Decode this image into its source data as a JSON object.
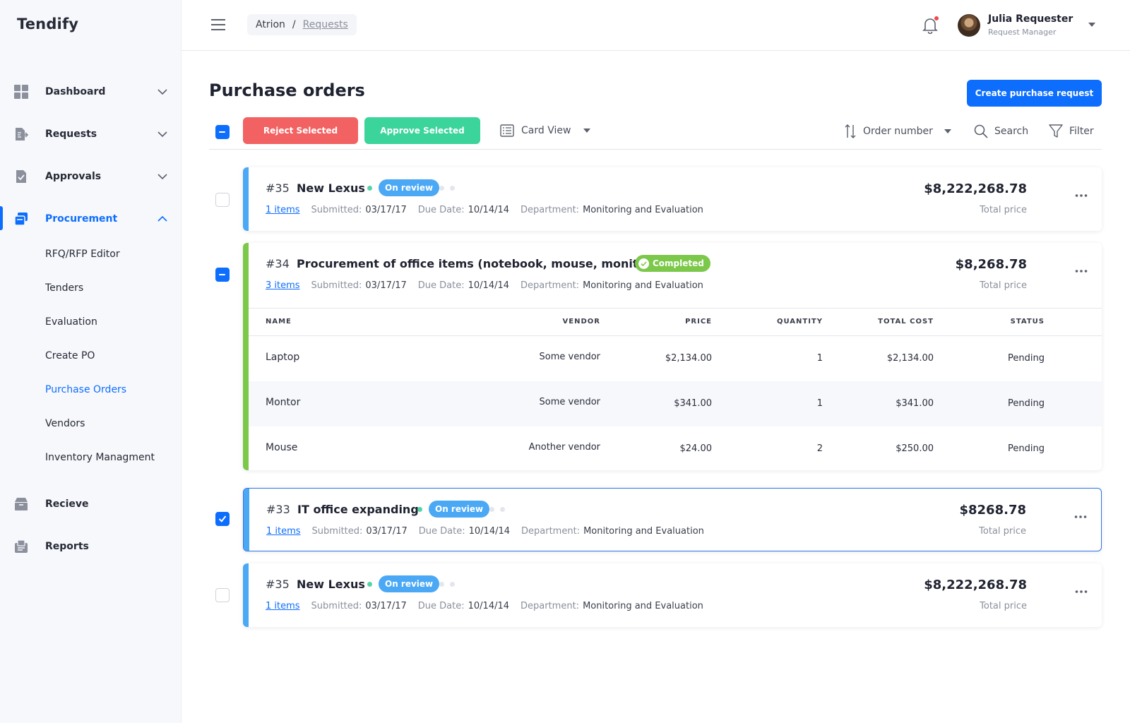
{
  "app": {
    "name": "Tendify"
  },
  "sidebar": {
    "items": [
      {
        "label": "Dashboard"
      },
      {
        "label": "Requests"
      },
      {
        "label": "Approvals"
      },
      {
        "label": "Procurement"
      },
      {
        "label": "Recieve"
      },
      {
        "label": "Reports"
      }
    ],
    "procurement_sub": [
      {
        "label": "RFQ/RFP Editor"
      },
      {
        "label": "Tenders"
      },
      {
        "label": "Evaluation"
      },
      {
        "label": "Create PO"
      },
      {
        "label": "Purchase Orders"
      },
      {
        "label": "Vendors"
      },
      {
        "label": "Inventory Managment"
      }
    ]
  },
  "header": {
    "breadcrumb": {
      "root": "Atrion",
      "separator": "/",
      "current": "Requests"
    },
    "user": {
      "name": "Julia Requester",
      "role": "Request Manager"
    }
  },
  "page": {
    "title": "Purchase orders",
    "create_button": "Create purchase request"
  },
  "toolbar": {
    "reject": "Reject Selected",
    "approve": "Approve Selected",
    "view": "Card View",
    "sort": "Order number",
    "search": "Search",
    "filter": "Filter"
  },
  "colors": {
    "accent": "#0d6efd",
    "reject": "#f26262",
    "approve": "#3bd49b",
    "on_review": "#4aa8f5",
    "completed": "#7cc84a"
  },
  "orders": [
    {
      "number": "#35",
      "title": "New Lexus",
      "status": "On review",
      "items_link": "1 items",
      "submitted_label": "Submitted:",
      "submitted": "03/17/17",
      "due_label": "Due Date:",
      "due": "10/14/14",
      "dept_label": "Department:",
      "department": "Monitoring and Evaluation",
      "price": "$8,222,268.78",
      "price_label": "Total price"
    },
    {
      "number": "#34",
      "title": "Procurement of office items (notebook, mouse, monitor)",
      "status": "Completed",
      "items_link": "3 items",
      "submitted_label": "Submitted:",
      "submitted": "03/17/17",
      "due_label": "Due Date:",
      "due": "10/14/14",
      "dept_label": "Department:",
      "department": "Monitoring and Evaluation",
      "price": "$8,268.78",
      "price_label": "Total price",
      "table": {
        "headers": [
          "NAME",
          "VENDOR",
          "PRICE",
          "QUANTITY",
          "TOTAL COST",
          "STATUS"
        ],
        "rows": [
          [
            "Laptop",
            "Some vendor",
            "$2,134.00",
            "1",
            "$2,134.00",
            "Pending"
          ],
          [
            "Montor",
            "Some vendor",
            "$341.00",
            "1",
            "$341.00",
            "Pending"
          ],
          [
            "Mouse",
            "Another vendor",
            "$24.00",
            "2",
            "$250.00",
            "Pending"
          ]
        ]
      }
    },
    {
      "number": "#33",
      "title": "IT office expanding",
      "status": "On review",
      "items_link": "1 items",
      "submitted_label": "Submitted:",
      "submitted": "03/17/17",
      "due_label": "Due Date:",
      "due": "10/14/14",
      "dept_label": "Department:",
      "department": "Monitoring and Evaluation",
      "price": "$8268.78",
      "price_label": "Total price"
    },
    {
      "number": "#35",
      "title": "New Lexus",
      "status": "On review",
      "items_link": "1 items",
      "submitted_label": "Submitted:",
      "submitted": "03/17/17",
      "due_label": "Due Date:",
      "due": "10/14/14",
      "dept_label": "Department:",
      "department": "Monitoring and Evaluation",
      "price": "$8,222,268.78",
      "price_label": "Total price"
    }
  ]
}
